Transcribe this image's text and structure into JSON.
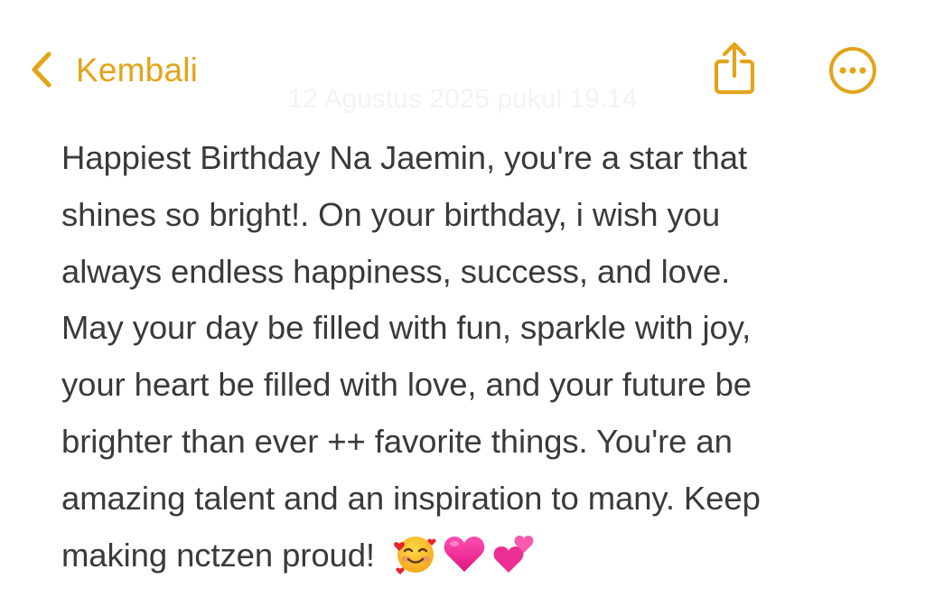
{
  "nav": {
    "back_label": "Kembali",
    "timestamp": "12 Agustus 2025 pukul 19.14",
    "accent_color": "#e3a41a"
  },
  "icons": {
    "back": "chevron-left-icon",
    "share": "share-icon",
    "more": "ellipsis-circle-icon"
  },
  "note": {
    "lines": [
      "Happiest Birthday Na Jaemin, you're a star that",
      "shines so bright!. On your birthday, i wish you",
      "always endless happiness, success, and love.",
      "May your day be filled with fun, sparkle with joy,",
      "your heart be filled with love, and your future be",
      "brighter than ever ++ favorite things. You're an",
      "amazing talent and an inspiration to many. Keep",
      "making nctzen proud!"
    ],
    "emojis": [
      "smiling-face-with-hearts",
      "pink-heart",
      "two-hearts"
    ],
    "text_color": "#3a3a3a"
  }
}
